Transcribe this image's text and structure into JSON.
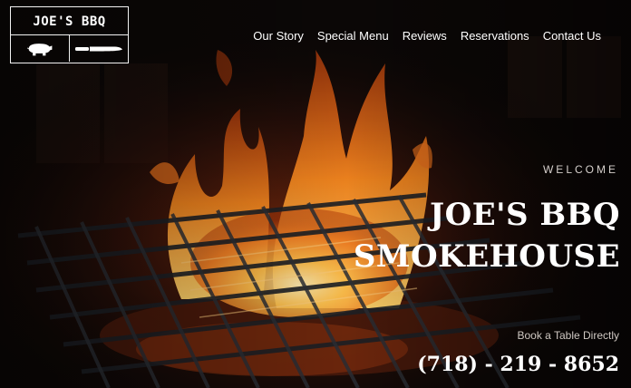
{
  "brand": {
    "name": "JOE'S BBQ",
    "icons": [
      "pig-icon",
      "knife-icon"
    ]
  },
  "nav": {
    "items": [
      {
        "label": "Our Story"
      },
      {
        "label": "Special Menu"
      },
      {
        "label": "Reviews"
      },
      {
        "label": "Reservations"
      },
      {
        "label": "Contact Us"
      }
    ]
  },
  "hero": {
    "eyebrow": "WELCOME",
    "title_line1": "JOE'S BBQ",
    "title_line2": "SMOKEHOUSE",
    "booking_text": "Book a Table Directly",
    "phone": "(718) - 219 - 8652",
    "background": "fire-grill-photo"
  },
  "colors": {
    "background": "#0b0706",
    "text": "#ffffff",
    "muted_text": "#d6d0cc",
    "flame": "#f07a1e"
  }
}
